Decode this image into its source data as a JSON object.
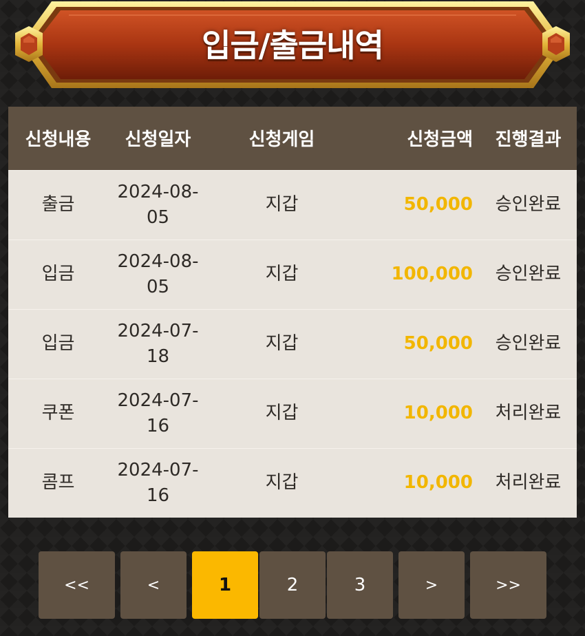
{
  "header": {
    "title": "입금/출금내역"
  },
  "colors": {
    "accent": "#fbb800",
    "amount": "#f2b600",
    "header_bg": "#5f5142",
    "row_bg": "#e9e4dd"
  },
  "table": {
    "columns": [
      "신청내용",
      "신청일자",
      "신청게임",
      "신청금액",
      "진행결과"
    ],
    "rows": [
      {
        "type": "출금",
        "date": "2024-08-05",
        "game": "지갑",
        "amount": "50,000",
        "result": "승인완료"
      },
      {
        "type": "입금",
        "date": "2024-08-05",
        "game": "지갑",
        "amount": "100,000",
        "result": "승인완료"
      },
      {
        "type": "입금",
        "date": "2024-07-18",
        "game": "지갑",
        "amount": "50,000",
        "result": "승인완료"
      },
      {
        "type": "쿠폰",
        "date": "2024-07-16",
        "game": "지갑",
        "amount": "10,000",
        "result": "처리완료"
      },
      {
        "type": "콤프",
        "date": "2024-07-16",
        "game": "지갑",
        "amount": "10,000",
        "result": "처리완료"
      }
    ]
  },
  "pagination": {
    "first": "<<",
    "prev": "<",
    "pages": [
      "1",
      "2",
      "3"
    ],
    "current": "1",
    "next": ">",
    "last": ">>"
  }
}
